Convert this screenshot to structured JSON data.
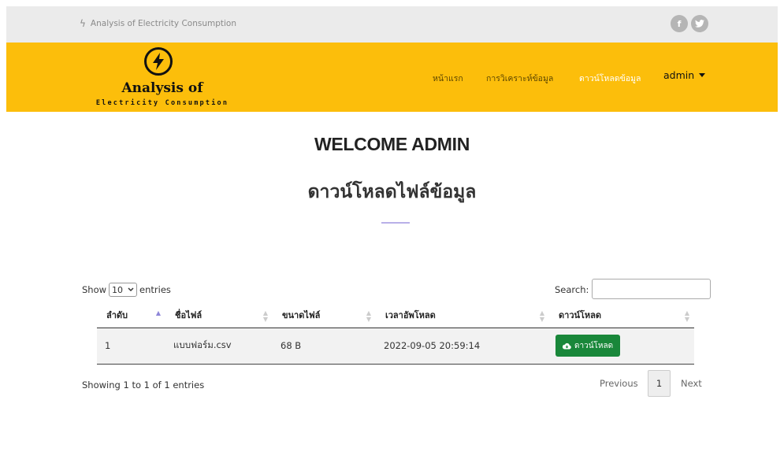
{
  "topbar": {
    "tagline": "Analysis of Electricity Consumption",
    "bolt_icon": "lightning-bolt-icon",
    "social": {
      "facebook": "f",
      "twitter": "t"
    }
  },
  "brand": {
    "title": "Analysis of",
    "subtitle": "Electricity Consumption",
    "logo_icon": "lightning-circle-icon"
  },
  "nav": {
    "home": "หน้าแรก",
    "analysis": "การวิเคราะห์ข้อมูล",
    "download": "ดาวน์โหลดข้อมูล",
    "user": "admin"
  },
  "main": {
    "welcome": "WELCOME ADMIN",
    "heading": "ดาวน์โหลดไฟล์ข้อมูล"
  },
  "table_controls": {
    "show": "Show",
    "entries_value": "10",
    "entries": "entries",
    "search_label": "Search:",
    "search_value": ""
  },
  "table": {
    "headers": [
      "ลำดับ",
      "ชื่อไฟล์",
      "ขนาดไฟล์",
      "เวลาอัพโหลด",
      "ดาวน์โหลด"
    ],
    "rows": [
      {
        "no": "1",
        "filename": "แบบฟอร์ม.csv",
        "size": "68 B",
        "uploaded": "2022-09-05 20:59:14",
        "action": "ดาวน์โหลด"
      }
    ]
  },
  "footer": {
    "info": "Showing 1 to 1 of 1 entries",
    "previous": "Previous",
    "page": "1",
    "next": "Next"
  },
  "colors": {
    "navbar": "#fcbe0b",
    "topbar": "#ebebeb",
    "download_button": "#19873a",
    "divider": "#b9b0e8"
  }
}
